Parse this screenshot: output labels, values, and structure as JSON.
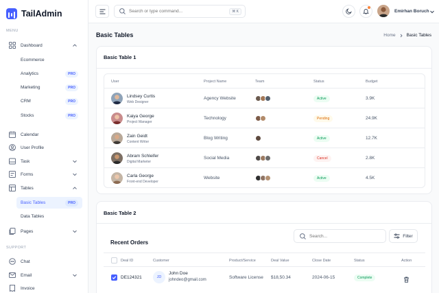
{
  "app": {
    "name": "TailAdmin"
  },
  "sidebar": {
    "menu_heading": "MENU",
    "support_heading": "SUPPORT",
    "dashboard": {
      "label": "Dashboard",
      "sub": [
        {
          "label": "Ecommerce",
          "pro": ""
        },
        {
          "label": "Analytics",
          "pro": "PRO"
        },
        {
          "label": "Marketing",
          "pro": "PRO"
        },
        {
          "label": "CRM",
          "pro": "PRO"
        },
        {
          "label": "Stocks",
          "pro": "PRO"
        }
      ]
    },
    "items": [
      {
        "label": "Calendar"
      },
      {
        "label": "User Profile"
      },
      {
        "label": "Task"
      },
      {
        "label": "Forms"
      },
      {
        "label": "Tables"
      }
    ],
    "tables_sub": [
      {
        "label": "Basic Tables",
        "pro": "PRO"
      },
      {
        "label": "Data Tables",
        "pro": ""
      }
    ],
    "pages": {
      "label": "Pages"
    },
    "support_items": [
      {
        "label": "Chat"
      },
      {
        "label": "Email"
      },
      {
        "label": "Invoice"
      }
    ]
  },
  "header": {
    "search_placeholder": "Search or type command...",
    "shortcut": "⌘ K",
    "user_name": "Emirhan Boruch"
  },
  "page": {
    "title": "Basic Tables",
    "breadcrumb_home": "Home",
    "breadcrumb_current": "Basic Tables"
  },
  "table1": {
    "title": "Basic Table 1",
    "columns": [
      "User",
      "Project Name",
      "Team",
      "Status",
      "Budget"
    ],
    "rows": [
      {
        "name": "Lindsey Curtis",
        "role": "Web Designer",
        "project": "Agency Website",
        "status": "Active",
        "budget": "3.9K"
      },
      {
        "name": "Kaiya George",
        "role": "Project Manager",
        "project": "Technology",
        "status": "Pending",
        "budget": "24.9K"
      },
      {
        "name": "Zain Geidt",
        "role": "Content Writer",
        "project": "Blog Writing",
        "status": "Active",
        "budget": "12.7K"
      },
      {
        "name": "Abram Schleifer",
        "role": "Digital Marketer",
        "project": "Social Media",
        "status": "Cancel",
        "budget": "2.8K"
      },
      {
        "name": "Carla George",
        "role": "Front-end Developer",
        "project": "Website",
        "status": "Active",
        "budget": "4.5K"
      }
    ]
  },
  "table2": {
    "title": "Basic Table 2",
    "recent_title": "Recent Orders",
    "search_placeholder": "Search...",
    "filter_label": "Filter",
    "columns": [
      "Deal ID",
      "Customer",
      "Product/Service",
      "Deal Value",
      "Close Date",
      "Status",
      "Action"
    ],
    "rows": [
      {
        "deal_id": "DE124321",
        "initials": "JD",
        "customer": "John Doe",
        "email": "johndeo@gmail.com",
        "product": "Software License",
        "value": "$18,50.34",
        "close_date": "2024-06-15",
        "status": "Complete"
      }
    ]
  },
  "colors": {
    "brand": "#465fff",
    "active_bg": "#ecfdf3",
    "active_fg": "#039855",
    "pending_bg": "#fffaeb",
    "pending_fg": "#dc6803",
    "cancel_bg": "#fef3f2",
    "cancel_fg": "#d92d20"
  }
}
